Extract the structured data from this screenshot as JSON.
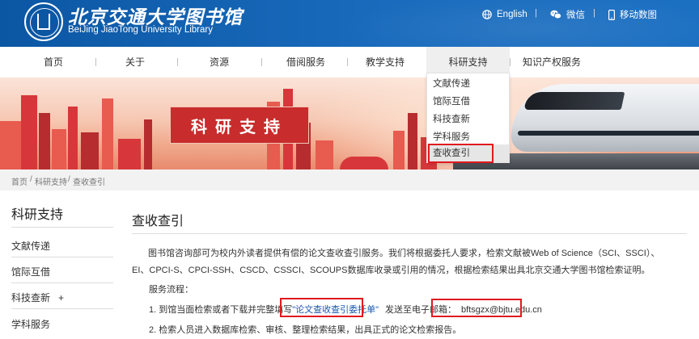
{
  "header": {
    "logo_cn": "北京交通大学图书馆",
    "logo_en": "BeiJing JiaoTong University Library",
    "tools": [
      {
        "label": "English",
        "icon": "globe-icon"
      },
      {
        "label": "微信",
        "icon": "wechat-icon"
      },
      {
        "label": "移动数图",
        "icon": "mobile-icon"
      }
    ],
    "tool_separator": "|",
    "colors": {
      "primary": "#0b57a4",
      "accent_red": "#e0191f"
    }
  },
  "nav": {
    "items": [
      {
        "label": "首页"
      },
      {
        "label": "关于"
      },
      {
        "label": "资源"
      },
      {
        "label": "借阅服务"
      },
      {
        "label": "教学支持"
      },
      {
        "label": "科研支持",
        "active": true
      },
      {
        "label": "知识产权服务"
      }
    ]
  },
  "dropdown": {
    "items": [
      {
        "label": "文献传递"
      },
      {
        "label": "馆际互借"
      },
      {
        "label": "科技查新"
      },
      {
        "label": "学科服务"
      },
      {
        "label": "查收查引",
        "selected": true
      }
    ]
  },
  "banner": {
    "title": "科研支持"
  },
  "breadcrumb": {
    "items": [
      "首页",
      "科研支持",
      "查收查引"
    ],
    "separator": "/"
  },
  "sidebar": {
    "title": "科研支持",
    "items": [
      {
        "label": "文献传递"
      },
      {
        "label": "馆际互借"
      },
      {
        "label": "科技查新",
        "expand": "+"
      },
      {
        "label": "学科服务"
      }
    ]
  },
  "content": {
    "title": "查收查引",
    "intro": "图书馆咨询部可为校内外读者提供有偿的论文查收查引服务。我们将根据委托人要求，检索文献被Web of Science（SCI、SSCI）、EI、CPCI-S、CPCI-SSH、CSCD、CSSCI、SCOUPS数据库收录或引用的情况，根据检索结果出具北京交通大学图书馆检索证明。",
    "process_label": "服务流程：",
    "step1_prefix": "1. 到馆当面检索或者下载并完整填写",
    "step1_link": "\"论文查收查引委托单\"",
    "step1_middle": "发送至电子邮箱：",
    "step1_email": "bftsgzx@bjtu.edu.cn",
    "step2": "2. 检索人员进入数据库检索、审核、整理检索结果，出具正式的论文检索报告。"
  }
}
